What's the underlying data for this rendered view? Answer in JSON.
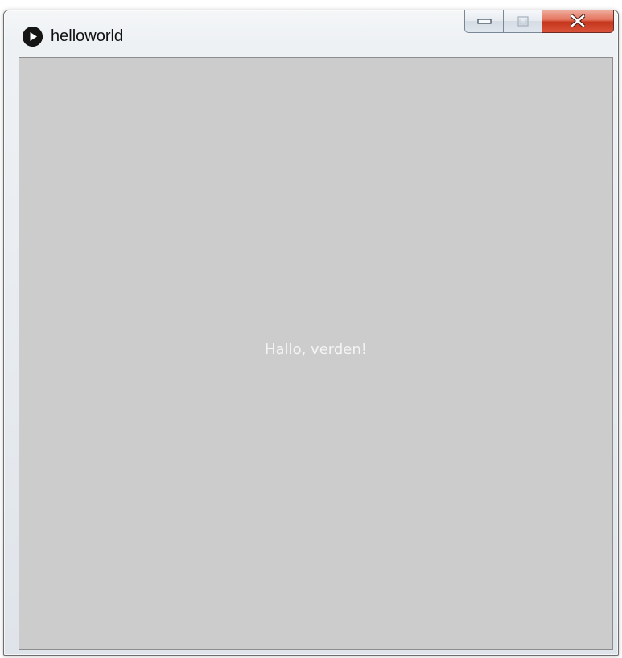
{
  "window": {
    "title": "helloworld",
    "icon": "processing-play-icon",
    "caption_buttons": [
      "minimize-icon",
      "maximize-icon",
      "close-icon"
    ]
  },
  "sketch": {
    "text": "Hallo, verden!",
    "background_color": "#cccccc",
    "text_color": "#f4f4f4"
  },
  "colors": {
    "close_button": "#d9533a",
    "title_text": "#111111"
  }
}
